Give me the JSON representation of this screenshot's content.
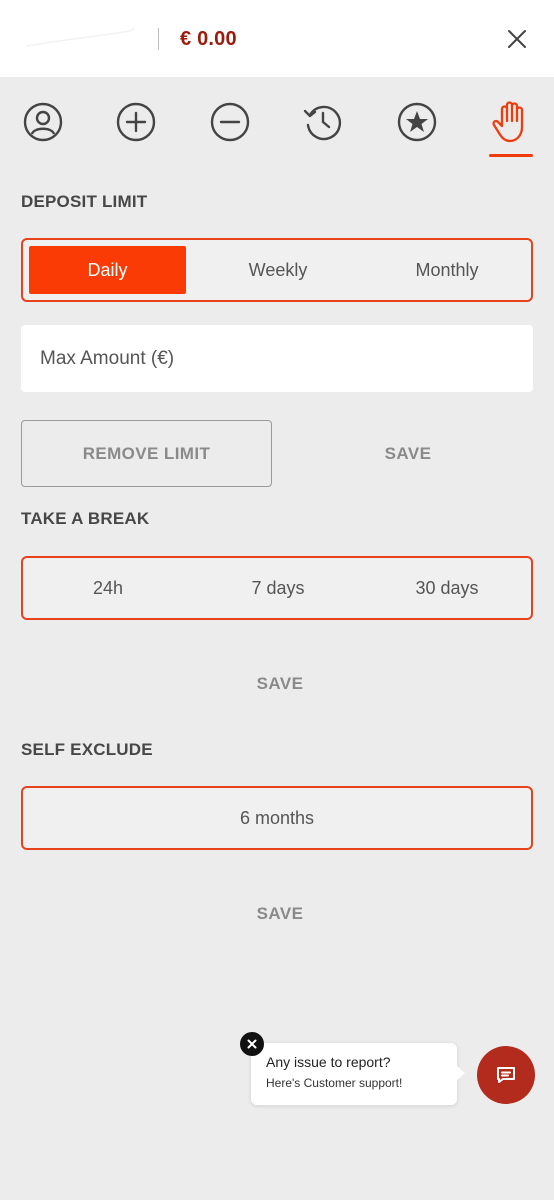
{
  "header": {
    "balance": "€ 0.00"
  },
  "nav_icons": [
    "profile-icon",
    "deposit-plus-icon",
    "withdraw-minus-icon",
    "history-icon",
    "favorites-star-icon",
    "responsible-gaming-hand-icon"
  ],
  "colors": {
    "accent": "#fb3b05",
    "accent_border": "#e8421c",
    "balance": "#9b1b0d",
    "chat_button": "#b32b1c",
    "background": "#ececec"
  },
  "deposit_limit": {
    "title": "DEPOSIT LIMIT",
    "periods": [
      "Daily",
      "Weekly",
      "Monthly"
    ],
    "selected": "Daily",
    "amount_placeholder": "Max Amount (€)",
    "remove_label": "REMOVE LIMIT",
    "save_label": "SAVE"
  },
  "take_a_break": {
    "title": "TAKE A BREAK",
    "options": [
      "24h",
      "7 days",
      "30 days"
    ],
    "save_label": "SAVE"
  },
  "self_exclude": {
    "title": "SELF EXCLUDE",
    "options": [
      "6 months"
    ],
    "save_label": "SAVE"
  },
  "support_chat": {
    "line1": "Any issue to report?",
    "line2": "Here's Customer support!"
  }
}
